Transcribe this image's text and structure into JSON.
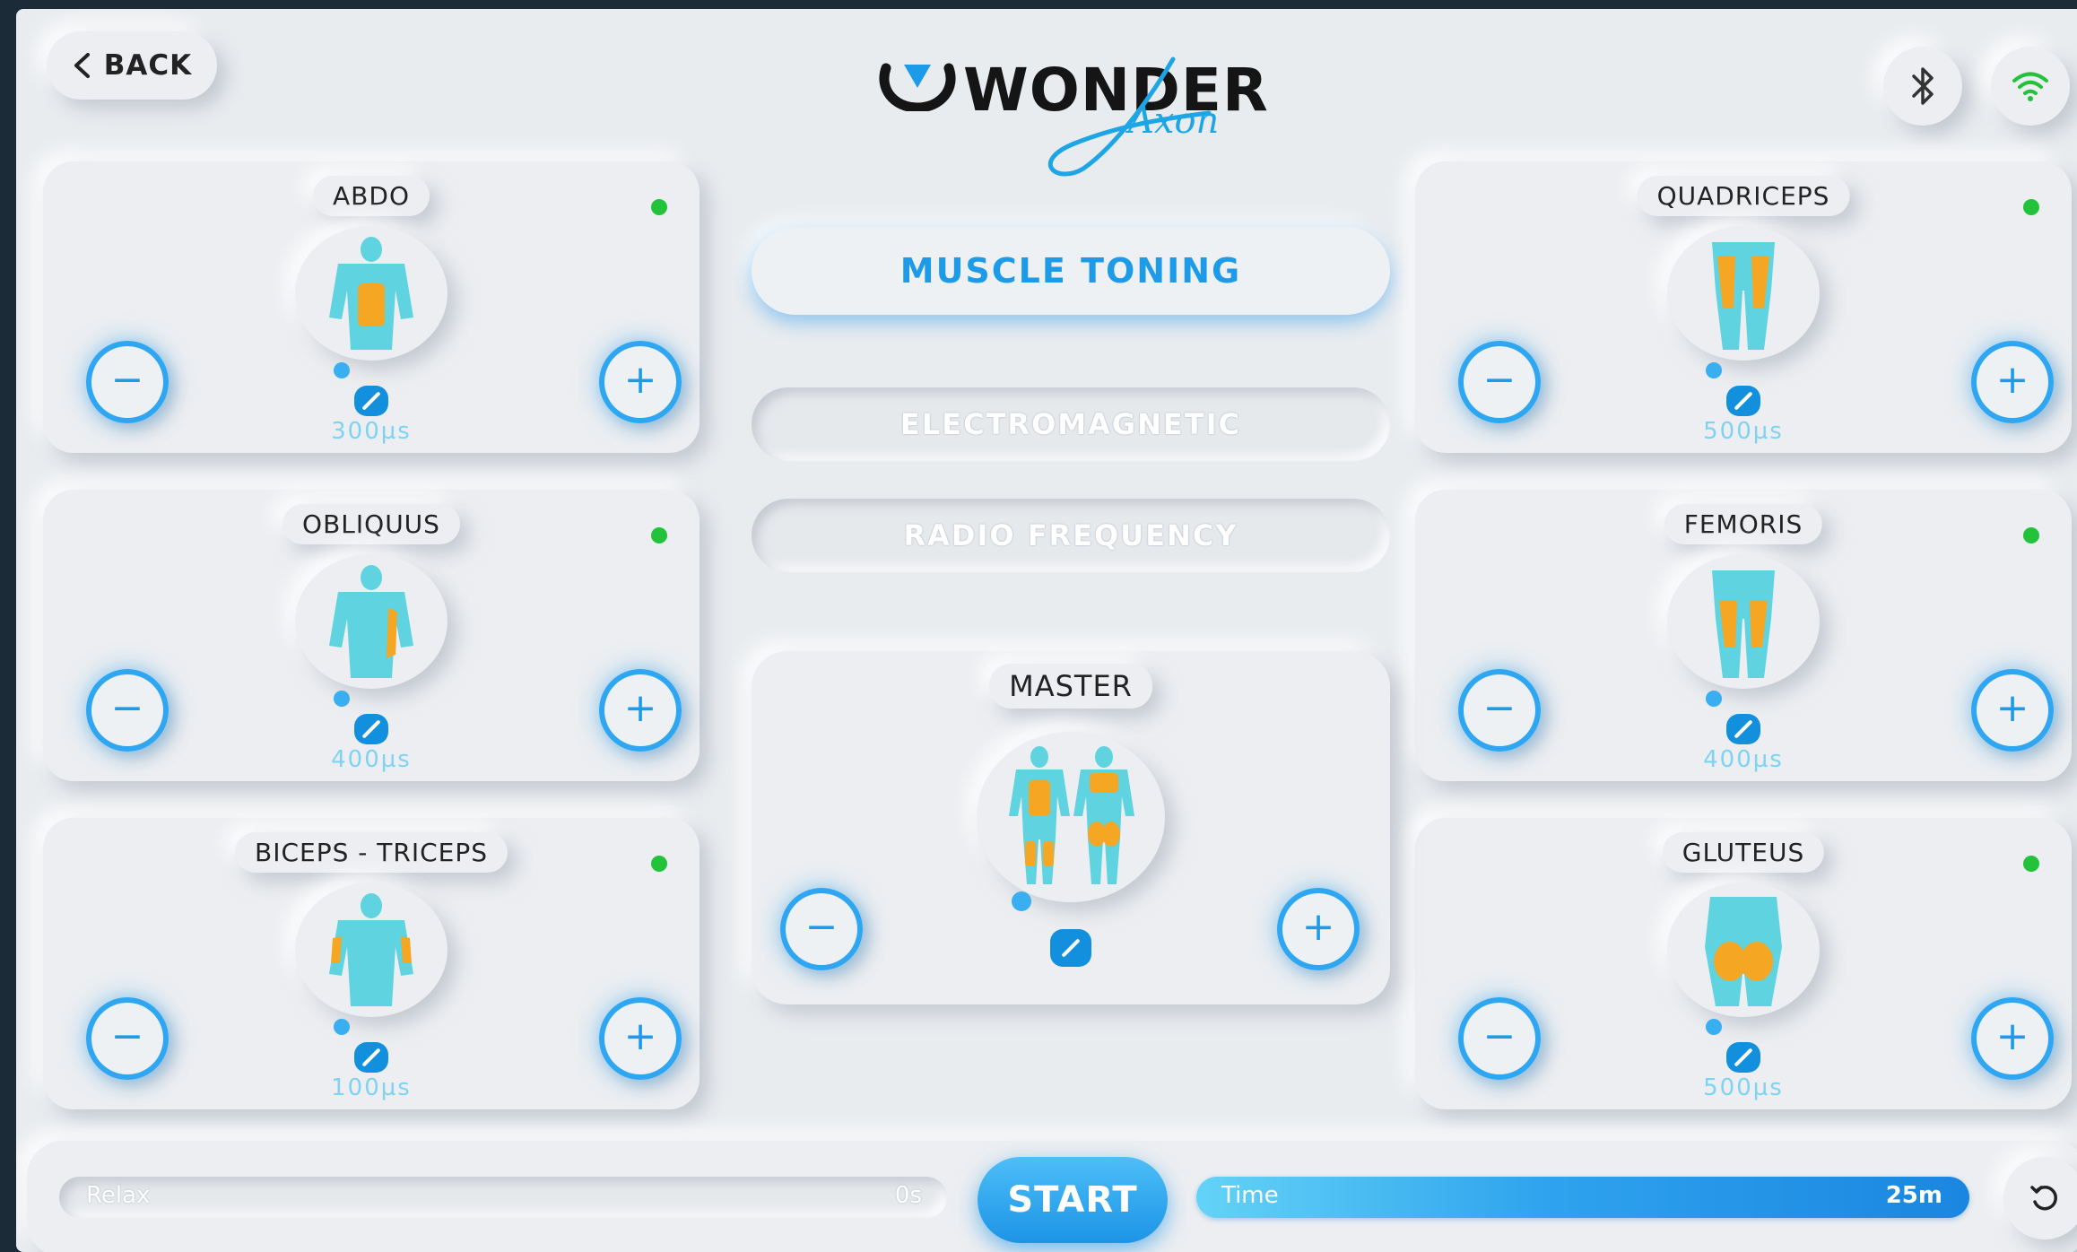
{
  "header": {
    "back_label": "BACK",
    "logo_word": "WONDER",
    "logo_script": "Axon",
    "bluetooth_icon": "bluetooth-icon",
    "wifi_icon": "wifi-icon",
    "wifi_color": "#22c33a"
  },
  "modes": {
    "active": "MUSCLE TONING",
    "electromagnetic": "ELECTROMAGNETIC",
    "radio_frequency": "RADIO FREQUENCY"
  },
  "muscles": {
    "abdo": {
      "label": "ABDO",
      "value": "300µs",
      "status": "active"
    },
    "obliquus": {
      "label": "OBLIQUUS",
      "value": "400µs",
      "status": "active"
    },
    "biceps": {
      "label": "BICEPS - TRICEPS",
      "value": "100µs",
      "status": "active"
    },
    "quadriceps": {
      "label": "QUADRICEPS",
      "value": "500µs",
      "status": "active"
    },
    "femoris": {
      "label": "FEMORIS",
      "value": "400µs",
      "status": "active"
    },
    "gluteus": {
      "label": "GLUTEUS",
      "value": "500µs",
      "status": "active"
    }
  },
  "master": {
    "label": "MASTER"
  },
  "controls": {
    "minus": "−",
    "plus": "+"
  },
  "footer": {
    "relax_label": "Relax",
    "relax_value": "0s",
    "start_label": "START",
    "time_label": "Time",
    "time_value": "25m"
  },
  "colors": {
    "accent": "#1e9be8",
    "status_dot": "#22c33a",
    "muscle_highlight": "#f5a623",
    "body": "#5fd3e0"
  }
}
